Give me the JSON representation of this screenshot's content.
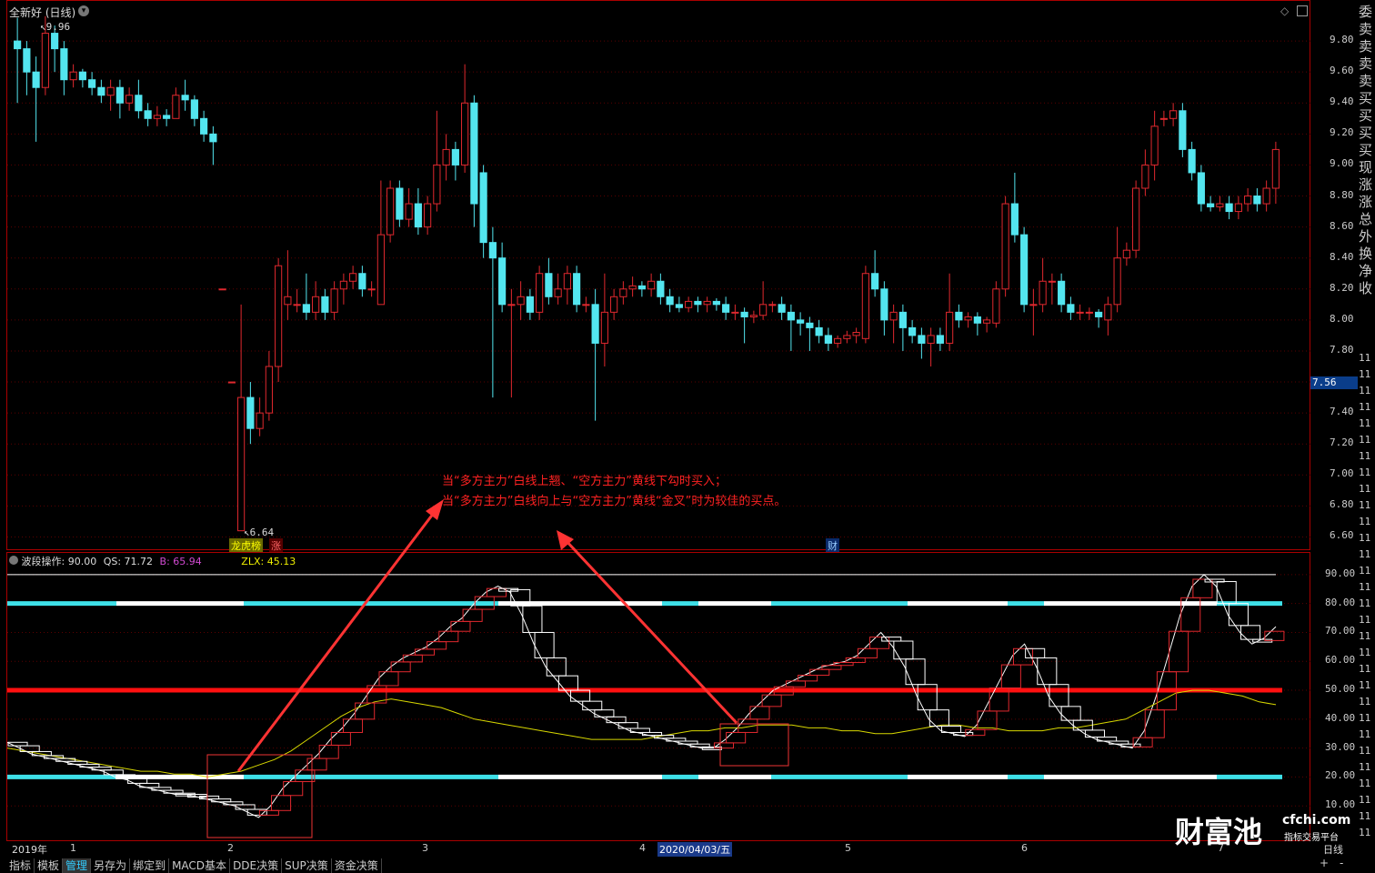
{
  "window": {
    "title": "全新好 (日线)",
    "period_label": "日线"
  },
  "price_axis": {
    "ticks": [
      "9.80",
      "9.60",
      "9.40",
      "9.20",
      "9.00",
      "8.80",
      "8.60",
      "8.40",
      "8.20",
      "8.00",
      "7.80",
      "7.60",
      "7.40",
      "7.20",
      "7.00",
      "6.80",
      "6.60"
    ],
    "current": "7.56"
  },
  "price_annotations": {
    "high": "9.96",
    "low": "6.64"
  },
  "event_markers": {
    "board": "龙虎榜",
    "rise": "涨",
    "finance": "财"
  },
  "indicator_header": {
    "name": "波段操作",
    "value": ": 90.00",
    "qs": "QS: 71.72",
    "b": "B: 65.94",
    "zlx": "ZLX: 45.13"
  },
  "indicator_axis": {
    "ticks": [
      "90.00",
      "80.00",
      "70.00",
      "60.00",
      "50.00",
      "40.00",
      "30.00",
      "20.00",
      "10.00"
    ]
  },
  "time_axis": {
    "year": "2019年",
    "months": [
      "1",
      "2",
      "3",
      "4",
      "5",
      "6",
      "7"
    ],
    "cursor_date": "2020/04/03/五"
  },
  "sidebar": {
    "labels": [
      "委",
      "卖",
      "卖",
      "卖",
      "卖",
      "买",
      "买",
      "买",
      "买",
      "现",
      "涨",
      "涨",
      "总",
      "外",
      "换",
      "净",
      "收"
    ],
    "right_ticks": [
      "11",
      "11",
      "11",
      "11",
      "11",
      "11",
      "11",
      "11",
      "11",
      "11",
      "11",
      "11",
      "11",
      "11",
      "11",
      "11",
      "11",
      "11",
      "11",
      "11",
      "11",
      "11",
      "11",
      "11",
      "11",
      "11",
      "11",
      "11",
      "11",
      "11"
    ]
  },
  "annotation": {
    "line1": "当“多方主力”白线上翘、“空方主力”黄线下勾时买入；",
    "line2": "当“多方主力”白线向上与“空方主力”黄线“金叉”时为较佳的买点。"
  },
  "bottom_tabs": [
    "指标",
    "模板",
    "管理",
    "另存为",
    "绑定到",
    "MACD基本",
    "DDE决策",
    "SUP决策",
    "资金决策"
  ],
  "watermark": {
    "brand": "财富池",
    "domain": "cfchi.com",
    "tagline": "指标交易平台"
  },
  "colors": {
    "up": "#e0282e",
    "down": "#53e5ef",
    "frame": "#a00000",
    "annotation": "#ff2222"
  },
  "chart_data": [
    {
      "type": "candlestick",
      "title": "全新好 (日线)",
      "ylim": [
        6.55,
        10.0
      ],
      "candles": [
        [
          9.8,
          9.75,
          9.95,
          9.4
        ],
        [
          9.75,
          9.6,
          9.8,
          9.45
        ],
        [
          9.6,
          9.5,
          9.7,
          9.15
        ],
        [
          9.5,
          9.85,
          9.96,
          9.45
        ],
        [
          9.85,
          9.75,
          9.9,
          9.6
        ],
        [
          9.75,
          9.55,
          9.8,
          9.45
        ],
        [
          9.55,
          9.6,
          9.65,
          9.5
        ],
        [
          9.6,
          9.55,
          9.62,
          9.5
        ],
        [
          9.55,
          9.5,
          9.6,
          9.45
        ],
        [
          9.5,
          9.45,
          9.55,
          9.4
        ],
        [
          9.45,
          9.5,
          9.55,
          9.35
        ],
        [
          9.5,
          9.4,
          9.55,
          9.3
        ],
        [
          9.4,
          9.45,
          9.5,
          9.35
        ],
        [
          9.45,
          9.35,
          9.55,
          9.3
        ],
        [
          9.35,
          9.3,
          9.4,
          9.25
        ],
        [
          9.3,
          9.32,
          9.38,
          9.25
        ],
        [
          9.32,
          9.3,
          9.36,
          9.25
        ],
        [
          9.3,
          9.45,
          9.5,
          9.3
        ],
        [
          9.45,
          9.42,
          9.55,
          9.35
        ],
        [
          9.42,
          9.3,
          9.45,
          9.25
        ],
        [
          9.3,
          9.2,
          9.35,
          9.15
        ],
        [
          9.2,
          9.15,
          9.25,
          9.0
        ],
        [
          8.2,
          8.2,
          8.2,
          8.2
        ],
        [
          7.6,
          7.6,
          7.6,
          7.6
        ],
        [
          6.64,
          7.5,
          8.1,
          6.64
        ],
        [
          7.5,
          7.3,
          7.6,
          7.2
        ],
        [
          7.3,
          7.4,
          7.5,
          7.25
        ],
        [
          7.4,
          7.7,
          7.8,
          7.35
        ],
        [
          7.7,
          8.35,
          8.4,
          7.6
        ],
        [
          8.1,
          8.15,
          8.45,
          8.0
        ],
        [
          8.1,
          8.1,
          8.2,
          8.05
        ],
        [
          8.1,
          8.05,
          8.3,
          8.0
        ],
        [
          8.05,
          8.15,
          8.25,
          8.0
        ],
        [
          8.15,
          8.05,
          8.2,
          8.0
        ],
        [
          8.05,
          8.2,
          8.25,
          8.0
        ],
        [
          8.2,
          8.25,
          8.3,
          8.1
        ],
        [
          8.25,
          8.3,
          8.35,
          8.2
        ],
        [
          8.3,
          8.2,
          8.35,
          8.15
        ],
        [
          8.2,
          8.2,
          8.25,
          8.15
        ],
        [
          8.1,
          8.55,
          8.9,
          8.1
        ],
        [
          8.55,
          8.85,
          8.9,
          8.5
        ],
        [
          8.85,
          8.65,
          8.9,
          8.6
        ],
        [
          8.65,
          8.75,
          8.85,
          8.6
        ],
        [
          8.75,
          8.6,
          8.85,
          8.55
        ],
        [
          8.6,
          8.75,
          8.8,
          8.55
        ],
        [
          8.75,
          9.0,
          9.35,
          8.7
        ],
        [
          9.0,
          9.1,
          9.2,
          8.9
        ],
        [
          9.1,
          9.0,
          9.15,
          8.9
        ],
        [
          9.0,
          9.4,
          9.65,
          8.95
        ],
        [
          9.4,
          8.75,
          9.45,
          8.6
        ],
        [
          8.95,
          8.5,
          9.0,
          8.4
        ],
        [
          8.5,
          8.4,
          8.6,
          7.5
        ],
        [
          8.4,
          8.1,
          8.5,
          8.05
        ],
        [
          8.1,
          8.1,
          8.2,
          7.5
        ],
        [
          8.1,
          8.15,
          8.25,
          8.0
        ],
        [
          8.15,
          8.05,
          8.2,
          8.0
        ],
        [
          8.05,
          8.3,
          8.35,
          8.0
        ],
        [
          8.3,
          8.15,
          8.4,
          8.1
        ],
        [
          8.15,
          8.2,
          8.3,
          8.1
        ],
        [
          8.2,
          8.3,
          8.35,
          8.1
        ],
        [
          8.3,
          8.1,
          8.35,
          8.05
        ],
        [
          8.1,
          8.1,
          8.15,
          8.05
        ],
        [
          8.1,
          7.85,
          8.2,
          7.35
        ],
        [
          7.85,
          8.05,
          8.3,
          7.7
        ],
        [
          8.05,
          8.15,
          8.2,
          8.0
        ],
        [
          8.15,
          8.2,
          8.25,
          8.1
        ],
        [
          8.2,
          8.22,
          8.28,
          8.15
        ],
        [
          8.22,
          8.2,
          8.25,
          8.15
        ],
        [
          8.2,
          8.25,
          8.3,
          8.15
        ],
        [
          8.25,
          8.15,
          8.3,
          8.1
        ],
        [
          8.15,
          8.1,
          8.2,
          8.05
        ],
        [
          8.1,
          8.08,
          8.15,
          8.05
        ],
        [
          8.08,
          8.12,
          8.15,
          8.05
        ],
        [
          8.12,
          8.1,
          8.15,
          8.05
        ],
        [
          8.1,
          8.12,
          8.15,
          8.05
        ],
        [
          8.12,
          8.1,
          8.14,
          8.06
        ],
        [
          8.1,
          8.05,
          8.15,
          8.0
        ],
        [
          8.05,
          8.05,
          8.1,
          8.0
        ],
        [
          8.05,
          8.02,
          8.08,
          7.85
        ],
        [
          8.02,
          8.03,
          8.06,
          7.98
        ],
        [
          8.03,
          8.1,
          8.25,
          8.0
        ],
        [
          8.1,
          8.1,
          8.12,
          8.05
        ],
        [
          8.1,
          8.05,
          8.15,
          8.0
        ],
        [
          8.05,
          8.0,
          8.1,
          7.8
        ],
        [
          8.0,
          7.98,
          8.05,
          7.9
        ],
        [
          7.98,
          7.95,
          8.02,
          7.8
        ],
        [
          7.95,
          7.9,
          8.0,
          7.85
        ],
        [
          7.9,
          7.85,
          7.95,
          7.8
        ],
        [
          7.85,
          7.88,
          7.9,
          7.82
        ],
        [
          7.88,
          7.9,
          7.93,
          7.85
        ],
        [
          7.9,
          7.92,
          7.95,
          7.85
        ],
        [
          7.88,
          8.3,
          8.35,
          7.85
        ],
        [
          8.3,
          8.2,
          8.45,
          8.15
        ],
        [
          8.2,
          8.0,
          8.25,
          7.9
        ],
        [
          8.0,
          8.05,
          8.1,
          7.85
        ],
        [
          8.05,
          7.95,
          8.1,
          7.8
        ],
        [
          7.95,
          7.9,
          8.0,
          7.85
        ],
        [
          7.9,
          7.85,
          7.95,
          7.75
        ],
        [
          7.85,
          7.9,
          7.95,
          7.7
        ],
        [
          7.9,
          7.85,
          7.95,
          7.8
        ],
        [
          7.85,
          8.05,
          8.3,
          7.8
        ],
        [
          8.05,
          8.0,
          8.1,
          7.95
        ],
        [
          8.0,
          8.02,
          8.05,
          7.95
        ],
        [
          8.02,
          7.98,
          8.05,
          7.9
        ],
        [
          7.98,
          8.0,
          8.02,
          7.92
        ],
        [
          7.98,
          8.2,
          8.25,
          7.95
        ],
        [
          8.2,
          8.75,
          8.8,
          8.15
        ],
        [
          8.75,
          8.55,
          8.95,
          8.5
        ],
        [
          8.55,
          8.1,
          8.6,
          8.05
        ],
        [
          8.1,
          8.1,
          8.2,
          7.9
        ],
        [
          8.1,
          8.25,
          8.4,
          8.05
        ],
        [
          8.25,
          8.25,
          8.3,
          8.1
        ],
        [
          8.25,
          8.1,
          8.3,
          8.05
        ],
        [
          8.1,
          8.05,
          8.15,
          8.0
        ],
        [
          8.05,
          8.05,
          8.1,
          8.0
        ],
        [
          8.05,
          8.05,
          8.08,
          8.0
        ],
        [
          8.05,
          8.02,
          8.07,
          7.95
        ],
        [
          8.0,
          8.1,
          8.15,
          7.9
        ],
        [
          8.1,
          8.4,
          8.6,
          8.05
        ],
        [
          8.4,
          8.45,
          8.5,
          8.35
        ],
        [
          8.45,
          8.85,
          8.9,
          8.4
        ],
        [
          8.85,
          9.0,
          9.1,
          8.8
        ],
        [
          9.0,
          9.25,
          9.35,
          8.9
        ],
        [
          9.3,
          9.3,
          9.35,
          9.25
        ],
        [
          9.3,
          9.35,
          9.4,
          9.25
        ],
        [
          9.35,
          9.1,
          9.4,
          9.05
        ],
        [
          9.1,
          8.95,
          9.15,
          8.9
        ],
        [
          8.95,
          8.75,
          9.0,
          8.7
        ],
        [
          8.75,
          8.73,
          8.8,
          8.7
        ],
        [
          8.73,
          8.75,
          8.8,
          8.7
        ],
        [
          8.75,
          8.7,
          8.8,
          8.65
        ],
        [
          8.7,
          8.75,
          8.8,
          8.65
        ],
        [
          8.75,
          8.8,
          8.85,
          8.7
        ],
        [
          8.8,
          8.75,
          8.85,
          8.7
        ],
        [
          8.75,
          8.85,
          8.9,
          8.7
        ],
        [
          8.85,
          9.1,
          9.15,
          8.75
        ]
      ]
    },
    {
      "type": "line",
      "title": "波段操作",
      "ylim": [
        0,
        95
      ],
      "reference_lines": [
        90,
        80,
        50,
        20
      ],
      "series": [
        {
          "name": "QS",
          "values": [
            32,
            30,
            28,
            27,
            26,
            25,
            24,
            23,
            22,
            20,
            19,
            17,
            16,
            15,
            14,
            14,
            13,
            12,
            11,
            10,
            8,
            6,
            10,
            16,
            20,
            24,
            28,
            33,
            37,
            42,
            48,
            54,
            58,
            61,
            63,
            65,
            68,
            72,
            75,
            80,
            84,
            86,
            84,
            76,
            66,
            58,
            53,
            48,
            45,
            42,
            40,
            38,
            36,
            35,
            34,
            33,
            32,
            31,
            30,
            30,
            33,
            37,
            42,
            46,
            50,
            52,
            54,
            56,
            58,
            59,
            60,
            62,
            66,
            70,
            65,
            58,
            48,
            40,
            36,
            35,
            34,
            38,
            46,
            54,
            62,
            66,
            58,
            48,
            42,
            38,
            35,
            33,
            32,
            31,
            30,
            36,
            48,
            62,
            76,
            86,
            90,
            86,
            76,
            70,
            66,
            68,
            72
          ]
        },
        {
          "name": "ZLX",
          "values": [
            30,
            29,
            28,
            27,
            26,
            25,
            24,
            23,
            22,
            22,
            21,
            21,
            20,
            21,
            22,
            24,
            26,
            29,
            33,
            37,
            41,
            44,
            46,
            47,
            46,
            45,
            44,
            42,
            40,
            39,
            38,
            37,
            36,
            35,
            34,
            33,
            33,
            33,
            33,
            34,
            35,
            36,
            36,
            37,
            37,
            38,
            38,
            38,
            37,
            37,
            36,
            36,
            35,
            35,
            36,
            37,
            38,
            38,
            37,
            37,
            36,
            36,
            36,
            37,
            37,
            38,
            39,
            40,
            43,
            46,
            49,
            50,
            50,
            49,
            48,
            46,
            45
          ]
        }
      ]
    }
  ]
}
